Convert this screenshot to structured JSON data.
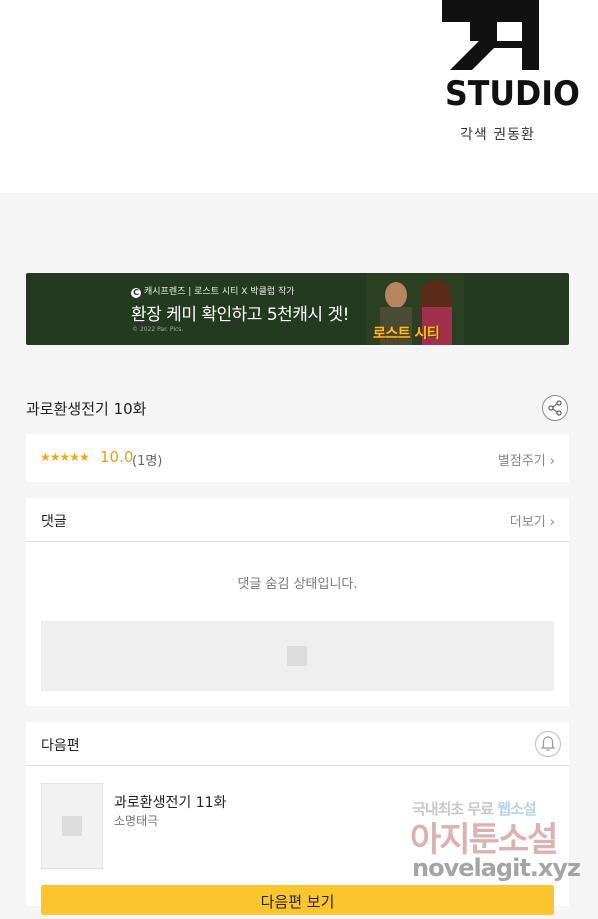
{
  "header": {
    "logo_text": "STUDIO",
    "credit": "각색 권동환"
  },
  "banner": {
    "brand_icon": "C",
    "brand_line": "캐시프렌즈 | 로스트 시티 X 박클럽 작가",
    "headline": "환장 케미 확인하고 5천캐시 겟!",
    "copyright": "© 2022 Par. Pics.",
    "poster_title": "로스트 시티"
  },
  "episode": {
    "title": "과로환생전기 10화"
  },
  "rating": {
    "stars": "★★★★★",
    "score": "10.0",
    "count": "(1명)",
    "rate_link": "별점주기 ›"
  },
  "comments": {
    "label": "댓글",
    "more_link": "더보기 ›",
    "hidden_message": "댓글 숨김 상태입니다."
  },
  "next_episode": {
    "label": "다음편",
    "title": "과로환생전기 11화",
    "author": "소명태극",
    "button": "다음편 보기"
  },
  "watermark": {
    "line1_a": "국내최초 무료 ",
    "line1_b": "웹소설",
    "line2": "아지툰소설",
    "line3": "novelagit.xyz"
  },
  "colors": {
    "banner_bg": "#233a21",
    "accent_yellow": "#fbc62d",
    "star": "#f3a91b"
  }
}
